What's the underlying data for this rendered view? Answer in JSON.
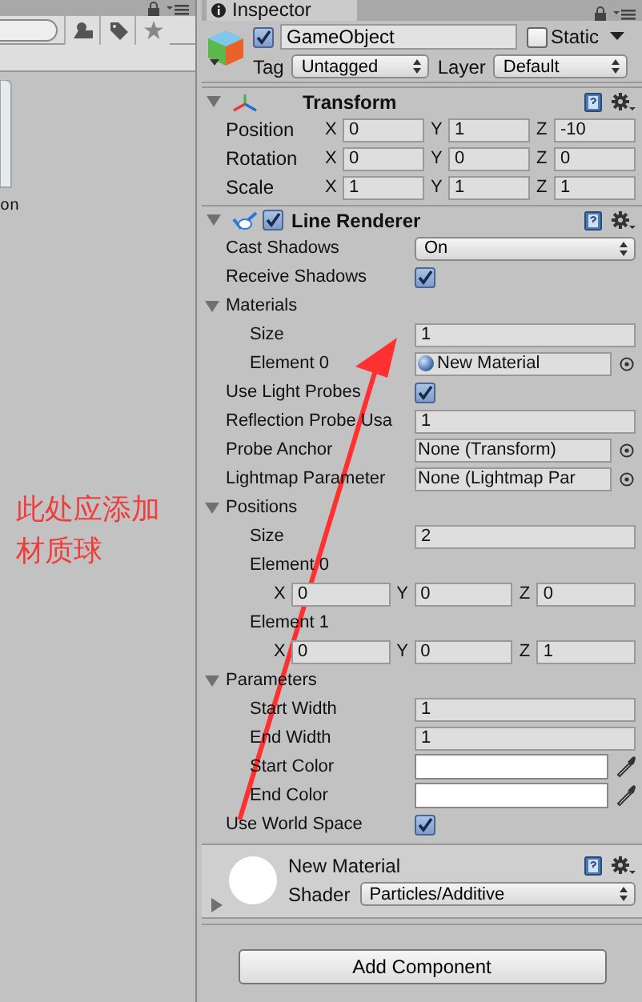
{
  "project_panel": {
    "asset": {
      "label": "on"
    }
  },
  "annotation": {
    "text": "此处应添加材质球"
  },
  "inspector": {
    "tab": "Inspector",
    "object": {
      "active": true,
      "name": "GameObject",
      "static": false,
      "static_label": "Static",
      "tag_label": "Tag",
      "tag": "Untagged",
      "layer_label": "Layer",
      "layer": "Default"
    },
    "components": [
      {
        "kind": "transform",
        "title": "Transform",
        "expanded": true,
        "rows": [
          {
            "label": "Position",
            "axes": [
              {
                "axis": "X",
                "value": "0"
              },
              {
                "axis": "Y",
                "value": "1"
              },
              {
                "axis": "Z",
                "value": "-10"
              }
            ]
          },
          {
            "label": "Rotation",
            "axes": [
              {
                "axis": "X",
                "value": "0"
              },
              {
                "axis": "Y",
                "value": "0"
              },
              {
                "axis": "Z",
                "value": "0"
              }
            ]
          },
          {
            "label": "Scale",
            "axes": [
              {
                "axis": "X",
                "value": "1"
              },
              {
                "axis": "Y",
                "value": "1"
              },
              {
                "axis": "Z",
                "value": "1"
              }
            ]
          }
        ]
      },
      {
        "kind": "properties",
        "title": "Line Renderer",
        "enabled": true,
        "expanded": true,
        "rows": [
          {
            "kind": "dropdown",
            "label": "Cast Shadows",
            "value": "On"
          },
          {
            "kind": "checkbox",
            "label": "Receive Shadows",
            "checked": true
          },
          {
            "kind": "foldout",
            "label": "Materials",
            "expanded": true,
            "children": [
              {
                "kind": "number",
                "label": "Size",
                "value": "1"
              },
              {
                "kind": "material",
                "label": "Element 0",
                "value": "New Material"
              }
            ]
          },
          {
            "kind": "checkbox",
            "label": "Use Light Probes",
            "checked": true
          },
          {
            "kind": "number",
            "label": "Reflection Probe Usa",
            "value": "1"
          },
          {
            "kind": "object",
            "label": "Probe Anchor",
            "value": "None (Transform)"
          },
          {
            "kind": "object",
            "label": "Lightmap Parameter",
            "value": "None (Lightmap Par"
          },
          {
            "kind": "foldout",
            "label": "Positions",
            "expanded": true,
            "children": [
              {
                "kind": "number",
                "label": "Size",
                "value": "2"
              },
              {
                "kind": "vector",
                "label": "Element 0",
                "axes": [
                  {
                    "axis": "X",
                    "value": "0"
                  },
                  {
                    "axis": "Y",
                    "value": "0"
                  },
                  {
                    "axis": "Z",
                    "value": "0"
                  }
                ]
              },
              {
                "kind": "vector",
                "label": "Element 1",
                "axes": [
                  {
                    "axis": "X",
                    "value": "0"
                  },
                  {
                    "axis": "Y",
                    "value": "0"
                  },
                  {
                    "axis": "Z",
                    "value": "1"
                  }
                ]
              }
            ]
          },
          {
            "kind": "foldout",
            "label": "Parameters",
            "expanded": true,
            "children": [
              {
                "kind": "number",
                "label": "Start Width",
                "value": "1"
              },
              {
                "kind": "number",
                "label": "End Width",
                "value": "1"
              },
              {
                "kind": "color",
                "label": "Start Color",
                "color": "#ffffff"
              },
              {
                "kind": "color",
                "label": "End Color",
                "color": "#ffffff"
              }
            ]
          },
          {
            "kind": "checkbox",
            "label": "Use World Space",
            "checked": true
          }
        ]
      }
    ],
    "material": {
      "name": "New Material",
      "expanded": false,
      "shader_label": "Shader",
      "shader": "Particles/Additive"
    },
    "add_component": "Add Component"
  }
}
